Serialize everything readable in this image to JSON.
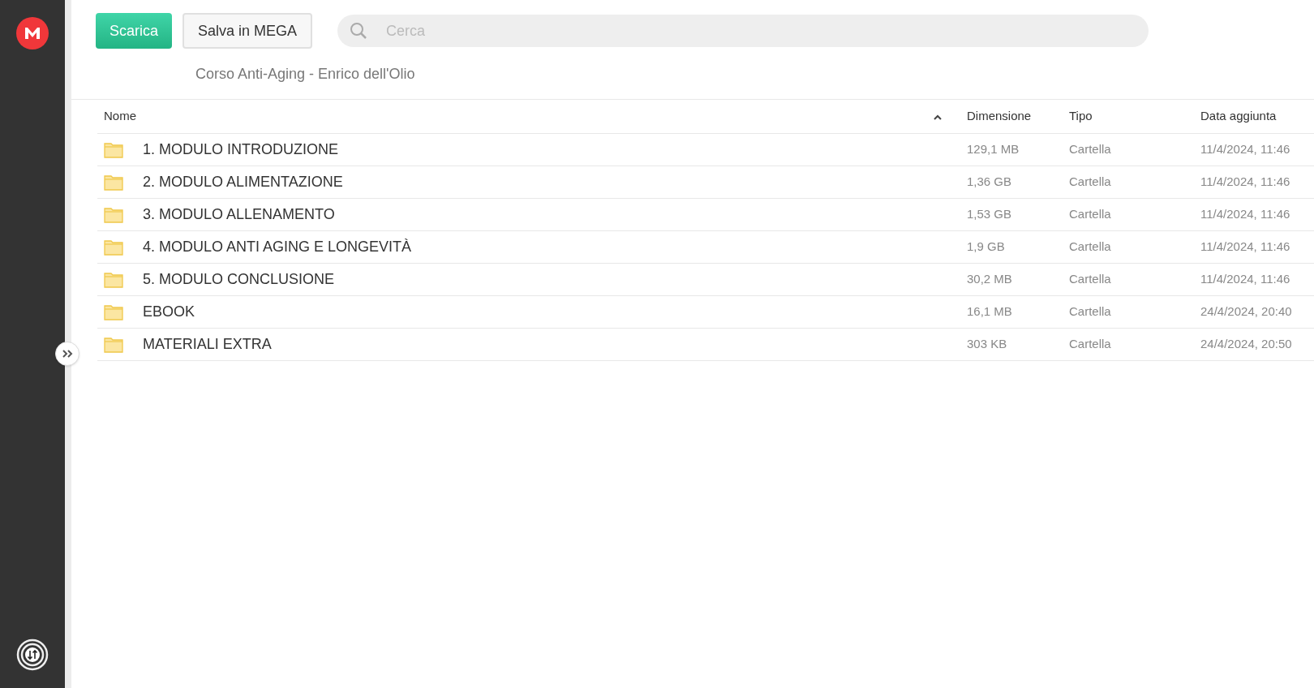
{
  "toolbar": {
    "buttons": [
      {
        "label": "Scarica",
        "kind": "primary"
      },
      {
        "label": "Salva in MEGA",
        "kind": "secondary"
      }
    ],
    "search": {
      "placeholder": "Cerca"
    }
  },
  "breadcrumb": "Corso Anti-Aging - Enrico dell'Olio",
  "table": {
    "columns": [
      "Nome",
      "Dimensione",
      "Tipo",
      "Data aggiunta"
    ],
    "rows": [
      {
        "name": "1. MODULO INTRODUZIONE",
        "size": "129,1 MB",
        "type": "Cartella",
        "date": "11/4/2024, 11:46"
      },
      {
        "name": "2. MODULO ALIMENTAZIONE",
        "size": "1,36 GB",
        "type": "Cartella",
        "date": "11/4/2024, 11:46"
      },
      {
        "name": "3. MODULO ALLENAMENTO",
        "size": "1,53 GB",
        "type": "Cartella",
        "date": "11/4/2024, 11:46"
      },
      {
        "name": "4. MODULO ANTI AGING E LONGEVITÀ",
        "size": "1,9 GB",
        "type": "Cartella",
        "date": "11/4/2024, 11:46"
      },
      {
        "name": "5. MODULO CONCLUSIONE",
        "size": "30,2 MB",
        "type": "Cartella",
        "date": "11/4/2024, 11:46"
      },
      {
        "name": "EBOOK",
        "size": "16,1 MB",
        "type": "Cartella",
        "date": "24/4/2024, 20:40"
      },
      {
        "name": "MATERIALI EXTRA",
        "size": "303 KB",
        "type": "Cartella",
        "date": "24/4/2024, 20:50"
      }
    ]
  }
}
